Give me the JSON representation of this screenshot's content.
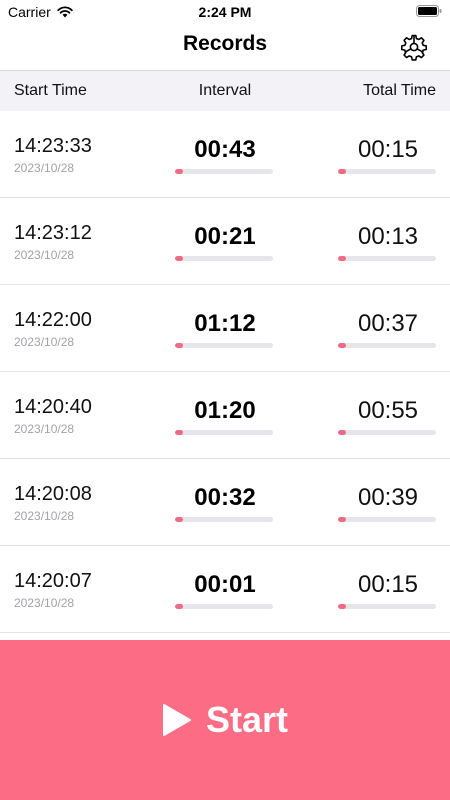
{
  "status_bar": {
    "carrier": "Carrier",
    "time": "2:24 PM"
  },
  "nav": {
    "title": "Records",
    "settings_icon": "gear-icon"
  },
  "table": {
    "headers": {
      "start_time": "Start Time",
      "interval": "Interval",
      "total_time": "Total Time"
    },
    "rows": [
      {
        "time": "14:23:33",
        "date": "2023/10/28",
        "interval": "00:43",
        "total": "00:15",
        "interval_progress": 0.08,
        "total_progress": 0.08
      },
      {
        "time": "14:23:12",
        "date": "2023/10/28",
        "interval": "00:21",
        "total": "00:13",
        "interval_progress": 0.08,
        "total_progress": 0.08
      },
      {
        "time": "14:22:00",
        "date": "2023/10/28",
        "interval": "01:12",
        "total": "00:37",
        "interval_progress": 0.08,
        "total_progress": 0.08
      },
      {
        "time": "14:20:40",
        "date": "2023/10/28",
        "interval": "01:20",
        "total": "00:55",
        "interval_progress": 0.08,
        "total_progress": 0.08
      },
      {
        "time": "14:20:08",
        "date": "2023/10/28",
        "interval": "00:32",
        "total": "00:39",
        "interval_progress": 0.08,
        "total_progress": 0.08
      },
      {
        "time": "14:20:07",
        "date": "2023/10/28",
        "interval": "00:01",
        "total": "00:15",
        "interval_progress": 0.08,
        "total_progress": 0.08
      }
    ]
  },
  "start_button": {
    "label": "Start",
    "icon": "play-icon"
  },
  "colors": {
    "accent": "#fd6c85",
    "progress_fill": "#f16a84",
    "progress_track": "#e6e6ea",
    "header_bg": "#f2f2f7"
  }
}
